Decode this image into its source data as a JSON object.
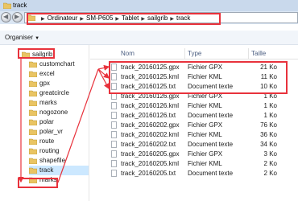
{
  "window": {
    "title": "track"
  },
  "address": {
    "crumbs": [
      "Ordinateur",
      "SM-P605",
      "Tablet",
      "sailgrib",
      "track"
    ]
  },
  "toolbar": {
    "organize_label": "Organiser"
  },
  "nav": {
    "items": [
      {
        "label": "sailgrib",
        "depth": 0,
        "highlighted": true
      },
      {
        "label": "customchart",
        "depth": 1
      },
      {
        "label": "excel",
        "depth": 1
      },
      {
        "label": "gpx",
        "depth": 1
      },
      {
        "label": "greatcircle",
        "depth": 1
      },
      {
        "label": "marks",
        "depth": 1
      },
      {
        "label": "nogozone",
        "depth": 1
      },
      {
        "label": "polar",
        "depth": 1
      },
      {
        "label": "polar_vr",
        "depth": 1
      },
      {
        "label": "route",
        "depth": 1
      },
      {
        "label": "routing",
        "depth": 1
      },
      {
        "label": "shapefile",
        "depth": 1
      },
      {
        "label": "track",
        "depth": 1,
        "selected": true,
        "highlighted": true
      },
      {
        "label": "marks",
        "depth": 1
      }
    ]
  },
  "columns": {
    "name": "Nom",
    "type": "Type",
    "size": "Taille"
  },
  "files": [
    {
      "name": "track_20160125.gpx",
      "type": "Fichier GPX",
      "size": "21 Ko",
      "highlighted": true
    },
    {
      "name": "track_20160125.kml",
      "type": "Fichier KML",
      "size": "11 Ko",
      "highlighted": true
    },
    {
      "name": "track_20160125.txt",
      "type": "Document texte",
      "size": "10 Ko",
      "highlighted": true
    },
    {
      "name": "track_20160126.gpx",
      "type": "Fichier GPX",
      "size": "1 Ko"
    },
    {
      "name": "track_20160126.kml",
      "type": "Fichier KML",
      "size": "1 Ko"
    },
    {
      "name": "track_20160126.txt",
      "type": "Document texte",
      "size": "1 Ko"
    },
    {
      "name": "track_20160202.gpx",
      "type": "Fichier GPX",
      "size": "76 Ko"
    },
    {
      "name": "track_20160202.kml",
      "type": "Fichier KML",
      "size": "36 Ko"
    },
    {
      "name": "track_20160202.txt",
      "type": "Document texte",
      "size": "34 Ko"
    },
    {
      "name": "track_20160205.gpx",
      "type": "Fichier GPX",
      "size": "3 Ko"
    },
    {
      "name": "track_20160205.kml",
      "type": "Fichier KML",
      "size": "2 Ko"
    },
    {
      "name": "track_20160205.txt",
      "type": "Document texte",
      "size": "2 Ko"
    }
  ],
  "colors": {
    "annotation": "#e8323c",
    "selection": "#cce8ff",
    "folder": "#e9c463",
    "titlebar": "#c9d9ec"
  },
  "icons": [
    "folder-icon",
    "back-arrow-icon",
    "forward-arrow-icon",
    "chevron-right-icon",
    "chevron-down-icon",
    "text-file-icon"
  ]
}
